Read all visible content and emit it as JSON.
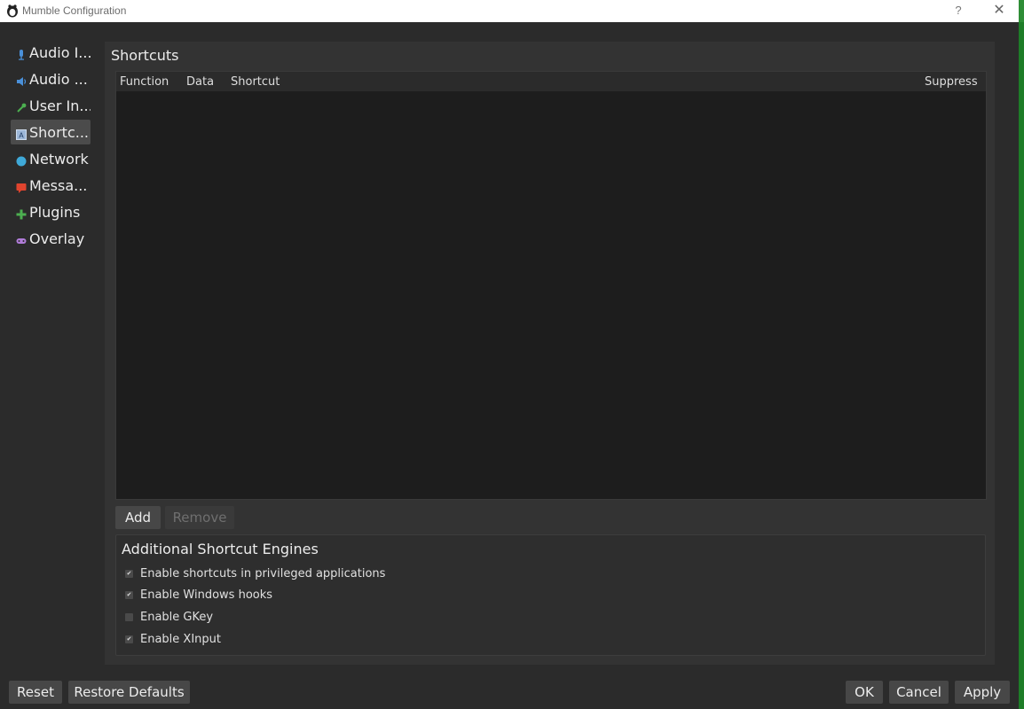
{
  "window": {
    "title": "Mumble Configuration",
    "help_label": "?",
    "close_label": "✕"
  },
  "sidebar": {
    "items": [
      {
        "label": "Audio I...",
        "icon": "microphone-icon",
        "color": "#4a90d9"
      },
      {
        "label": "Audio ...",
        "icon": "speaker-icon",
        "color": "#4a90d9"
      },
      {
        "label": "User In...",
        "icon": "wrench-icon",
        "color": "#4caf50"
      },
      {
        "label": "Shortc...",
        "icon": "keyboard-icon",
        "color": "#7a9cc6",
        "active": true
      },
      {
        "label": "Network",
        "icon": "globe-icon",
        "color": "#3fa9d8"
      },
      {
        "label": "Messa...",
        "icon": "message-icon",
        "color": "#e0442e"
      },
      {
        "label": "Plugins",
        "icon": "puzzle-icon",
        "color": "#4caf50"
      },
      {
        "label": "Overlay",
        "icon": "gamepad-icon",
        "color": "#b07cd8"
      }
    ]
  },
  "shortcuts": {
    "title": "Shortcuts",
    "columns": {
      "function": "Function",
      "data": "Data",
      "shortcut": "Shortcut",
      "suppress": "Suppress"
    },
    "rows": [],
    "add_label": "Add",
    "remove_label": "Remove"
  },
  "engines": {
    "title": "Additional Shortcut Engines",
    "options": [
      {
        "label": "Enable shortcuts in privileged applications",
        "checked": true
      },
      {
        "label": "Enable Windows hooks",
        "checked": true
      },
      {
        "label": "Enable GKey",
        "checked": false
      },
      {
        "label": "Enable XInput",
        "checked": true
      }
    ]
  },
  "footer": {
    "reset_label": "Reset",
    "restore_label": "Restore Defaults",
    "ok_label": "OK",
    "cancel_label": "Cancel",
    "apply_label": "Apply"
  },
  "colors": {
    "background": "#2b2b2b",
    "panel": "#333333",
    "list": "#1d1d1d",
    "button": "#474747",
    "accent_green": "#1e7d28"
  }
}
